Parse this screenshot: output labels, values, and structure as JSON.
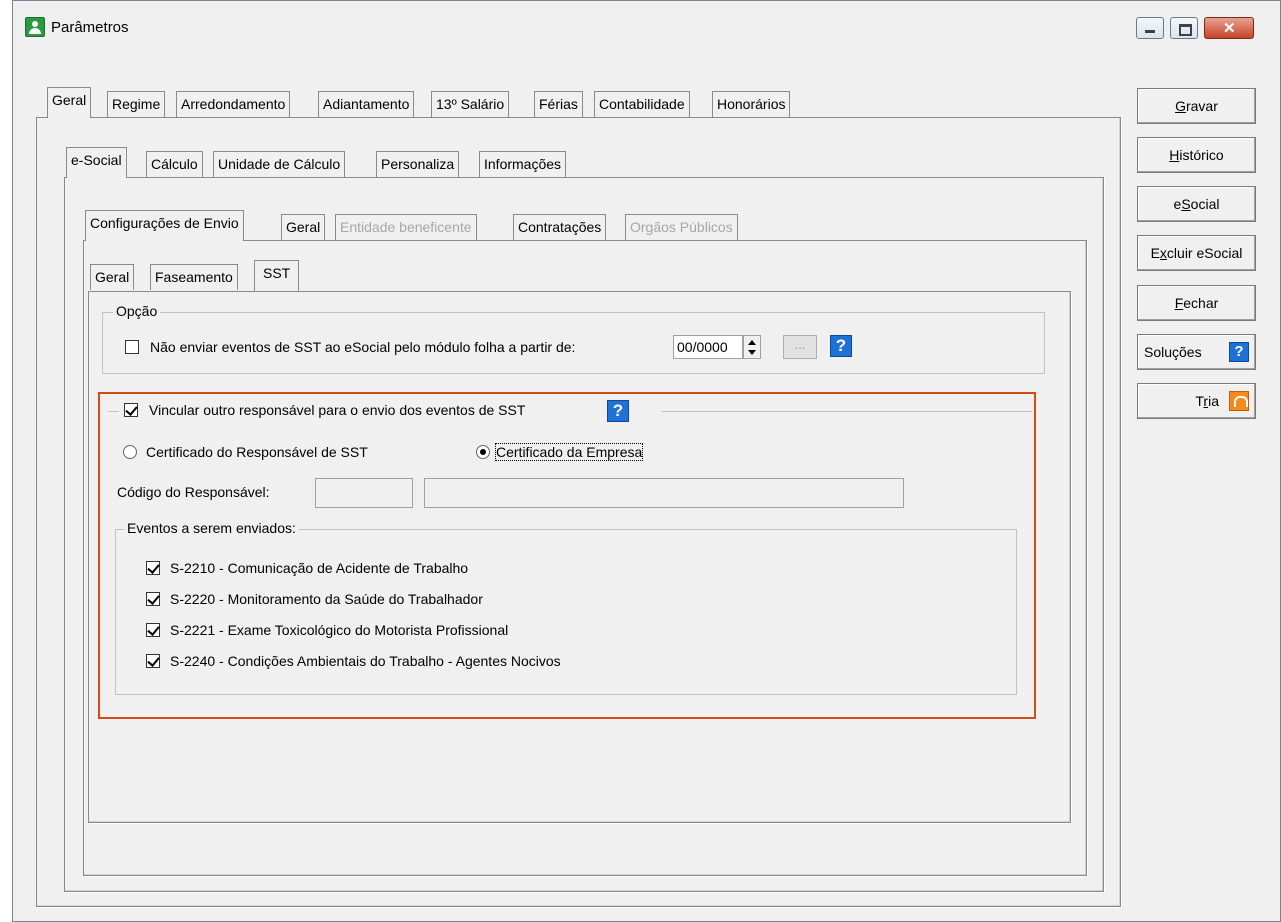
{
  "window": {
    "title": "Parâmetros"
  },
  "tabs_level1": [
    "Geral",
    "Regime",
    "Arredondamento",
    "Adiantamento",
    "13º Salário",
    "Férias",
    "Contabilidade",
    "Honorários"
  ],
  "tabs_level2": [
    "e-Social",
    "Cálculo",
    "Unidade de Cálculo",
    "Personaliza",
    "Informações"
  ],
  "tabs_level3": [
    "Configurações de Envio",
    "Geral",
    "Entidade beneficente",
    "Contratações",
    "Orgãos Públicos"
  ],
  "tabs_level4": [
    "Geral",
    "Faseamento",
    "SST"
  ],
  "opcao": {
    "legend": "Opção",
    "checkbox_label": "Não enviar eventos de SST ao eSocial pelo módulo folha a partir de:",
    "date_value": "00/0000",
    "browse_label": "..."
  },
  "vincular": {
    "label": "Vincular outro responsável para o envio dos eventos de SST",
    "radio_responsavel": "Certificado do Responsável de SST",
    "radio_empresa": "Certificado da Empresa",
    "codigo_label": "Código do Responsável:",
    "codigo_value": "",
    "nome_value": ""
  },
  "eventos": {
    "legend": "Eventos a serem enviados:",
    "items": [
      "S-2210 - Comunicação de Acidente de Trabalho",
      "S-2220 - Monitoramento da Saúde do Trabalhador",
      "S-2221 - Exame Toxicológico do Motorista Profissional",
      "S-2240 - Condições Ambientais do Trabalho - Agentes Nocivos"
    ]
  },
  "side": {
    "gravar": {
      "pre": "",
      "key": "G",
      "post": "ravar"
    },
    "historico": {
      "pre": "",
      "key": "H",
      "post": "istórico"
    },
    "esocial": {
      "pre": "e",
      "key": "S",
      "post": "ocial"
    },
    "excluir": {
      "pre": "E",
      "key": "x",
      "post": "cluir eSocial"
    },
    "fechar": {
      "pre": "",
      "key": "F",
      "post": "echar"
    },
    "solucoes": "Soluções",
    "tria": {
      "pre": "T",
      "key": "r",
      "post": "ia"
    }
  },
  "colors": {
    "highlight": "#d24c1b",
    "help": "#1e72d6",
    "tria": "#f28a1e"
  }
}
